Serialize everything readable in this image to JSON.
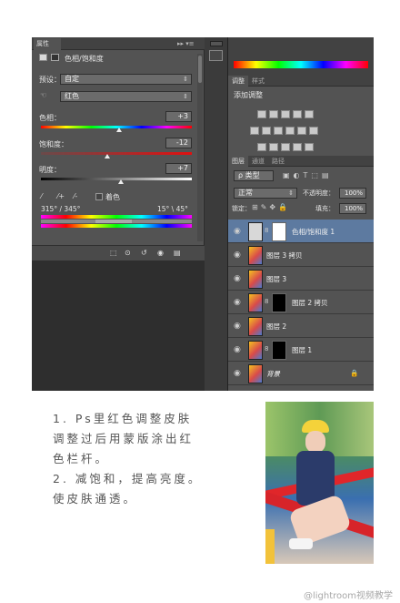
{
  "properties": {
    "tab": "属性",
    "controls": "▸▸ ▾≡",
    "title": "色相/饱和度",
    "preset_label": "预设：",
    "preset_value": "自定",
    "channel_value": "红色",
    "hue_label": "色相：",
    "hue_value": "+3",
    "hue_level": 0.52,
    "sat_label": "饱和度：",
    "sat_value": "-12",
    "sat_level": 0.44,
    "light_label": "明度：",
    "light_value": "+7",
    "light_level": 0.53,
    "colorize_label": "着色",
    "range_left": "315° / 345°",
    "range_right": "15° \\ 45°"
  },
  "adjustments": {
    "tab_active": "调整",
    "tab_other": "样式",
    "heading": "添加调整"
  },
  "layers": {
    "tabs": [
      "图层",
      "通道",
      "路径"
    ],
    "filter": "ρ 类型",
    "blend_mode": "正常",
    "opacity_label": "不透明度：",
    "opacity_value": "100%",
    "lock_label": "锁定：",
    "fill_label": "填充：",
    "fill_value": "100%",
    "items": [
      {
        "name": "色相/饱和度 1",
        "type": "adjustment",
        "selected": true
      },
      {
        "name": "图层 3 拷贝",
        "type": "pixel"
      },
      {
        "name": "图层 3",
        "type": "pixel"
      },
      {
        "name": "图层 2 拷贝",
        "type": "masked"
      },
      {
        "name": "图层 2",
        "type": "pixel"
      },
      {
        "name": "图层 1",
        "type": "masked"
      },
      {
        "name": "背景",
        "type": "background"
      }
    ]
  },
  "caption": {
    "line1": "1. Ps里红色调整皮肤",
    "line2": "调整过后用蒙版涂出红",
    "line3": "色栏杆。",
    "line4": "2. 减饱和，提高亮度。",
    "line5": "使皮肤通透。"
  },
  "watermark": "@lightroom视频教学"
}
